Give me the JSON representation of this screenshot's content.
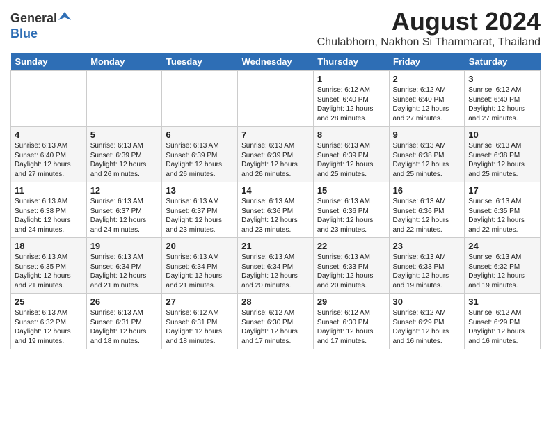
{
  "logo": {
    "general": "General",
    "blue": "Blue"
  },
  "title": "August 2024",
  "location": "Chulabhorn, Nakhon Si Thammarat, Thailand",
  "weekdays": [
    "Sunday",
    "Monday",
    "Tuesday",
    "Wednesday",
    "Thursday",
    "Friday",
    "Saturday"
  ],
  "weeks": [
    [
      {
        "day": "",
        "content": ""
      },
      {
        "day": "",
        "content": ""
      },
      {
        "day": "",
        "content": ""
      },
      {
        "day": "",
        "content": ""
      },
      {
        "day": "1",
        "content": "Sunrise: 6:12 AM\nSunset: 6:40 PM\nDaylight: 12 hours\nand 28 minutes."
      },
      {
        "day": "2",
        "content": "Sunrise: 6:12 AM\nSunset: 6:40 PM\nDaylight: 12 hours\nand 27 minutes."
      },
      {
        "day": "3",
        "content": "Sunrise: 6:12 AM\nSunset: 6:40 PM\nDaylight: 12 hours\nand 27 minutes."
      }
    ],
    [
      {
        "day": "4",
        "content": "Sunrise: 6:13 AM\nSunset: 6:40 PM\nDaylight: 12 hours\nand 27 minutes."
      },
      {
        "day": "5",
        "content": "Sunrise: 6:13 AM\nSunset: 6:39 PM\nDaylight: 12 hours\nand 26 minutes."
      },
      {
        "day": "6",
        "content": "Sunrise: 6:13 AM\nSunset: 6:39 PM\nDaylight: 12 hours\nand 26 minutes."
      },
      {
        "day": "7",
        "content": "Sunrise: 6:13 AM\nSunset: 6:39 PM\nDaylight: 12 hours\nand 26 minutes."
      },
      {
        "day": "8",
        "content": "Sunrise: 6:13 AM\nSunset: 6:39 PM\nDaylight: 12 hours\nand 25 minutes."
      },
      {
        "day": "9",
        "content": "Sunrise: 6:13 AM\nSunset: 6:38 PM\nDaylight: 12 hours\nand 25 minutes."
      },
      {
        "day": "10",
        "content": "Sunrise: 6:13 AM\nSunset: 6:38 PM\nDaylight: 12 hours\nand 25 minutes."
      }
    ],
    [
      {
        "day": "11",
        "content": "Sunrise: 6:13 AM\nSunset: 6:38 PM\nDaylight: 12 hours\nand 24 minutes."
      },
      {
        "day": "12",
        "content": "Sunrise: 6:13 AM\nSunset: 6:37 PM\nDaylight: 12 hours\nand 24 minutes."
      },
      {
        "day": "13",
        "content": "Sunrise: 6:13 AM\nSunset: 6:37 PM\nDaylight: 12 hours\nand 23 minutes."
      },
      {
        "day": "14",
        "content": "Sunrise: 6:13 AM\nSunset: 6:36 PM\nDaylight: 12 hours\nand 23 minutes."
      },
      {
        "day": "15",
        "content": "Sunrise: 6:13 AM\nSunset: 6:36 PM\nDaylight: 12 hours\nand 23 minutes."
      },
      {
        "day": "16",
        "content": "Sunrise: 6:13 AM\nSunset: 6:36 PM\nDaylight: 12 hours\nand 22 minutes."
      },
      {
        "day": "17",
        "content": "Sunrise: 6:13 AM\nSunset: 6:35 PM\nDaylight: 12 hours\nand 22 minutes."
      }
    ],
    [
      {
        "day": "18",
        "content": "Sunrise: 6:13 AM\nSunset: 6:35 PM\nDaylight: 12 hours\nand 21 minutes."
      },
      {
        "day": "19",
        "content": "Sunrise: 6:13 AM\nSunset: 6:34 PM\nDaylight: 12 hours\nand 21 minutes."
      },
      {
        "day": "20",
        "content": "Sunrise: 6:13 AM\nSunset: 6:34 PM\nDaylight: 12 hours\nand 21 minutes."
      },
      {
        "day": "21",
        "content": "Sunrise: 6:13 AM\nSunset: 6:34 PM\nDaylight: 12 hours\nand 20 minutes."
      },
      {
        "day": "22",
        "content": "Sunrise: 6:13 AM\nSunset: 6:33 PM\nDaylight: 12 hours\nand 20 minutes."
      },
      {
        "day": "23",
        "content": "Sunrise: 6:13 AM\nSunset: 6:33 PM\nDaylight: 12 hours\nand 19 minutes."
      },
      {
        "day": "24",
        "content": "Sunrise: 6:13 AM\nSunset: 6:32 PM\nDaylight: 12 hours\nand 19 minutes."
      }
    ],
    [
      {
        "day": "25",
        "content": "Sunrise: 6:13 AM\nSunset: 6:32 PM\nDaylight: 12 hours\nand 19 minutes."
      },
      {
        "day": "26",
        "content": "Sunrise: 6:13 AM\nSunset: 6:31 PM\nDaylight: 12 hours\nand 18 minutes."
      },
      {
        "day": "27",
        "content": "Sunrise: 6:12 AM\nSunset: 6:31 PM\nDaylight: 12 hours\nand 18 minutes."
      },
      {
        "day": "28",
        "content": "Sunrise: 6:12 AM\nSunset: 6:30 PM\nDaylight: 12 hours\nand 17 minutes."
      },
      {
        "day": "29",
        "content": "Sunrise: 6:12 AM\nSunset: 6:30 PM\nDaylight: 12 hours\nand 17 minutes."
      },
      {
        "day": "30",
        "content": "Sunrise: 6:12 AM\nSunset: 6:29 PM\nDaylight: 12 hours\nand 16 minutes."
      },
      {
        "day": "31",
        "content": "Sunrise: 6:12 AM\nSunset: 6:29 PM\nDaylight: 12 hours\nand 16 minutes."
      }
    ]
  ]
}
